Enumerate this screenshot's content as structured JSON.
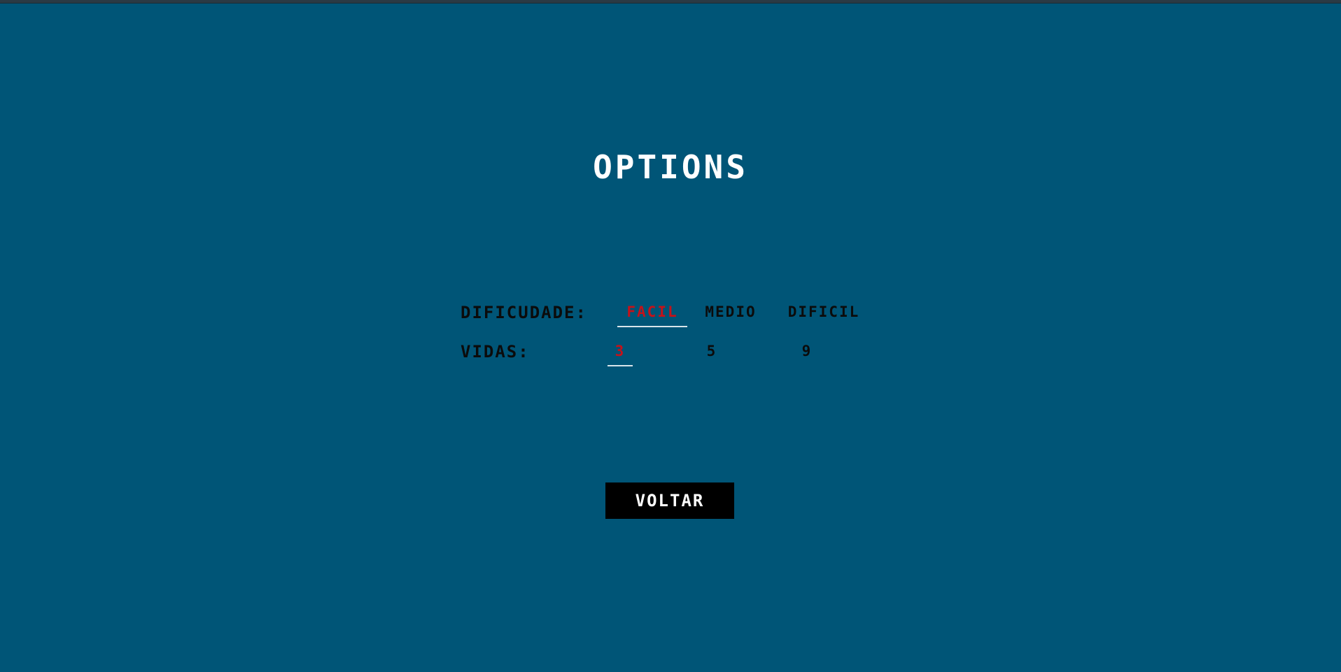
{
  "screen": {
    "title": "OPTIONS"
  },
  "options": {
    "dificuldade": {
      "label": "DIFICUDADE:",
      "choices": [
        "FACIL",
        "MEDIO",
        "DIFICIL"
      ],
      "selected": "FACIL"
    },
    "vidas": {
      "label": "VIDAS:",
      "choices": [
        "3",
        "5",
        "9"
      ],
      "selected": "3"
    }
  },
  "actions": {
    "back_label": "VOLTAR"
  },
  "colors": {
    "background": "#005577",
    "selected_option": "#c4121a",
    "button_background": "#000000",
    "title_text": "#ffffff"
  }
}
